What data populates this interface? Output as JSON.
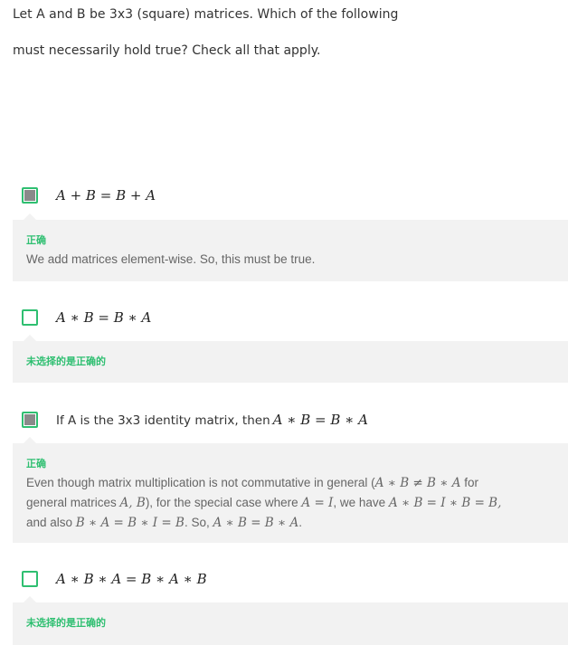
{
  "question": {
    "line1": "Let A and B be 3x3 (square) matrices. Which of the following",
    "line2": "must necessarily hold true? Check all that apply."
  },
  "options": [
    {
      "label": "A + B = B + A",
      "checked": true,
      "status": "正确",
      "explanation": "We add matrices element-wise. So, this must be true."
    },
    {
      "label": "A ∗ B = B ∗ A",
      "checked": false,
      "status": "未选择的是正确的"
    },
    {
      "label_text": "If A is the 3x3 identity matrix, then",
      "label_math": "A ∗ B = B ∗ A",
      "checked": true,
      "status": "正确",
      "explanation": {
        "l1a": "Even though matrix multiplication is not commutative in general (",
        "l1m": "A ∗ B ≠ B ∗ A",
        "l1b": " for",
        "l2a": "general matrices ",
        "l2m1": "A, B",
        "l2b": "), for the special case where ",
        "l2m2": "A = I",
        "l2c": ", we have ",
        "l2m3": "A ∗ B = I ∗ B = B,",
        "l3a": "and also ",
        "l3m1": "B ∗ A = B ∗ I = B",
        "l3b": ". So, ",
        "l3m2": "A ∗ B = B ∗ A",
        "l3c": "."
      }
    },
    {
      "label": "A ∗ B ∗ A = B ∗ A ∗ B",
      "checked": false,
      "status": "未选择的是正确的"
    }
  ],
  "colors": {
    "accent": "#2fbf71",
    "feedback_bg": "#f2f2f2",
    "check_fill": "#8a8a8a"
  }
}
